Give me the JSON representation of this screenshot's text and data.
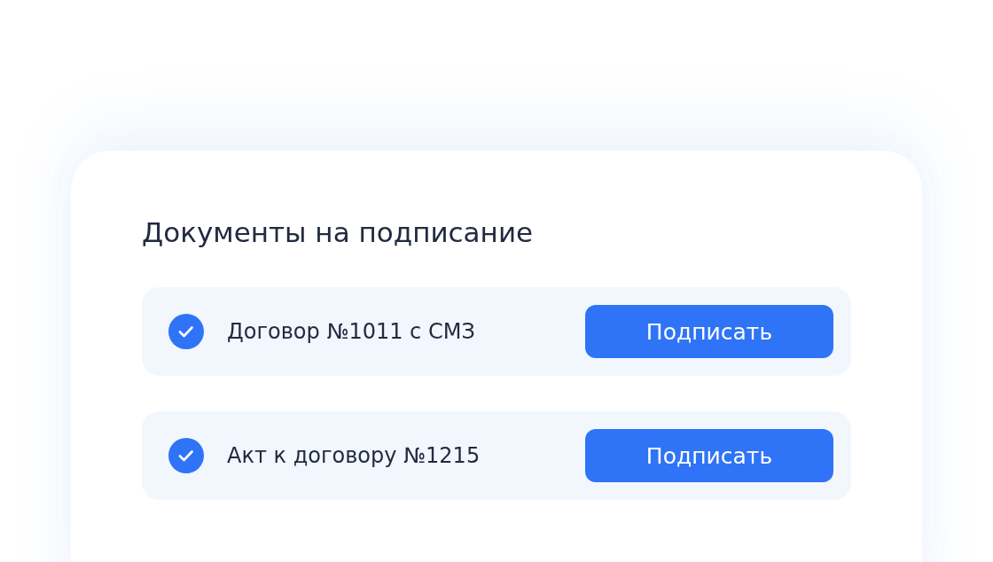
{
  "title": "Документы на подписание",
  "documents": [
    {
      "name": "Договор №1011 с СМЗ",
      "checked": true,
      "action": "Подписать"
    },
    {
      "name": "Акт к договору №1215",
      "checked": true,
      "action": "Подписать"
    }
  ]
}
